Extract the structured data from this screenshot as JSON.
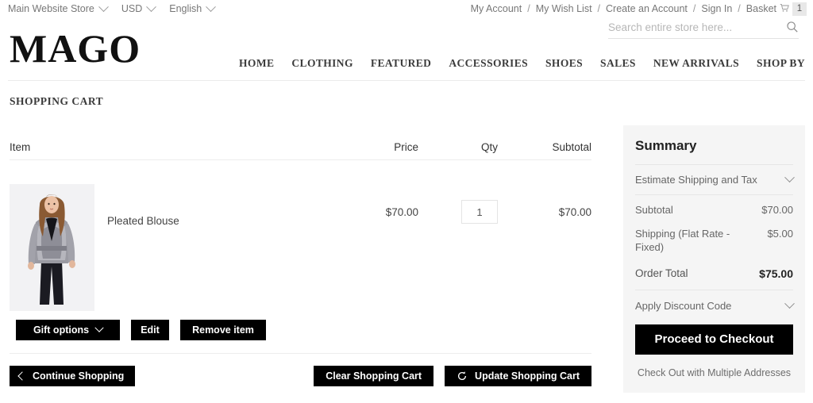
{
  "topbar": {
    "switchers": [
      {
        "label": "Main Website Store",
        "icon": "chevron-down-icon"
      },
      {
        "label": "USD",
        "icon": "chevron-down-icon"
      },
      {
        "label": "English",
        "icon": "chevron-down-icon"
      }
    ],
    "account_links": [
      {
        "label": "My Account"
      },
      {
        "label": "My Wish List"
      },
      {
        "label": "Create an Account"
      },
      {
        "label": "Sign In"
      }
    ],
    "separator": "/",
    "basket": {
      "label": "Basket",
      "icon": "cart-icon",
      "count": "1"
    }
  },
  "header": {
    "logo": "MAGO",
    "search": {
      "placeholder": "Search entire store here...",
      "value": "",
      "icon": "search-icon"
    },
    "nav": [
      {
        "label": "HOME"
      },
      {
        "label": "CLOTHING"
      },
      {
        "label": "FEATURED"
      },
      {
        "label": "ACCESSORIES"
      },
      {
        "label": "SHOES"
      },
      {
        "label": "SALES"
      },
      {
        "label": "NEW ARRIVALS"
      },
      {
        "label": "SHOP BY"
      }
    ]
  },
  "page": {
    "title": "SHOPPING CART"
  },
  "cart": {
    "columns": {
      "item": "Item",
      "price": "Price",
      "qty": "Qty",
      "subtotal": "Subtotal"
    },
    "rows": [
      {
        "name": "Pleated Blouse",
        "price": "$70.00",
        "qty": "1",
        "subtotal": "$70.00"
      }
    ],
    "item_actions": {
      "gift_options": "Gift options",
      "gift_options_icon": "chevron-down-icon",
      "edit": "Edit",
      "remove": "Remove item"
    },
    "bottom_actions": {
      "continue": "Continue Shopping",
      "continue_icon": "chevron-left-icon",
      "clear": "Clear Shopping Cart",
      "update": "Update Shopping Cart",
      "update_icon": "refresh-icon"
    }
  },
  "summary": {
    "title": "Summary",
    "estimate": {
      "label": "Estimate Shipping and Tax",
      "icon": "chevron-down-icon"
    },
    "rows": [
      {
        "label": "Subtotal",
        "value": "$70.00"
      },
      {
        "label": "Shipping (Flat Rate - Fixed)",
        "value": "$5.00"
      }
    ],
    "total": {
      "label": "Order Total",
      "value": "$75.00"
    },
    "discount": {
      "label": "Apply Discount Code",
      "icon": "chevron-down-icon"
    },
    "checkout": "Proceed to Checkout",
    "multi_address": "Check Out with Multiple Addresses"
  },
  "colors": {
    "button_bg": "#000000",
    "summary_bg": "#f5f5f5",
    "text": "#333333",
    "muted": "#777777",
    "rule": "#ededed"
  }
}
